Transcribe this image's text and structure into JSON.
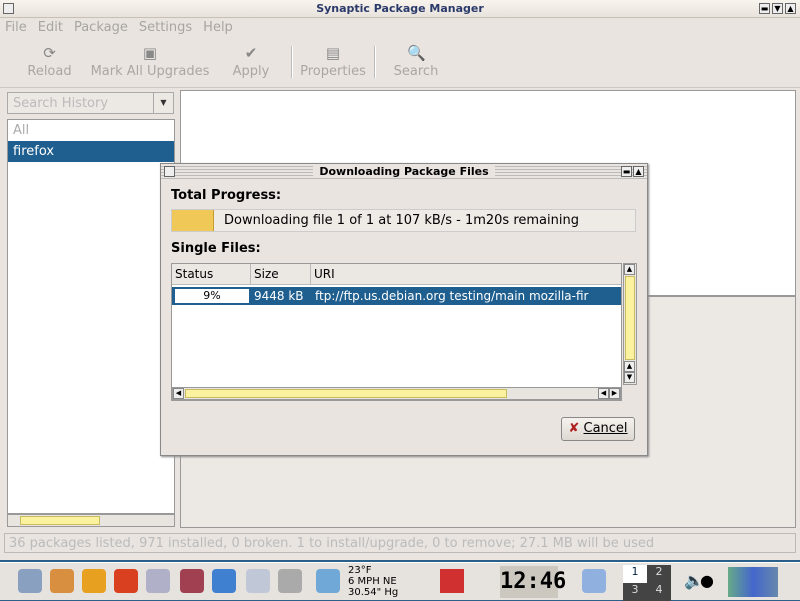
{
  "window": {
    "title": "Synaptic Package Manager"
  },
  "menu": [
    "File",
    "Edit",
    "Package",
    "Settings",
    "Help"
  ],
  "toolbar": {
    "reload": "Reload",
    "mark_all": "Mark All Upgrades",
    "apply": "Apply",
    "properties": "Properties",
    "search": "Search"
  },
  "sidebar": {
    "combo": "Search History",
    "items": [
      "All",
      "firefox"
    ]
  },
  "status": "36 packages listed, 971 installed, 0 broken. 1 to install/upgrade, 0 to remove; 27.1 MB will be used",
  "dialog": {
    "title": "Downloading Package Files",
    "total_label": "Total Progress:",
    "total_text": "Downloading file 1 of 1 at 107 kB/s - 1m20s remaining",
    "total_progress": 0.09,
    "single_label": "Single Files:",
    "columns": [
      "Status",
      "Size",
      "URI"
    ],
    "rows": [
      {
        "status": "9%",
        "size": "9448 kB",
        "uri": "ftp://ftp.us.debian.org testing/main mozilla-fir"
      }
    ],
    "cancel": "Cancel"
  },
  "taskbar": {
    "weather": [
      "23°F",
      "6 MPH NE",
      "30.54\" Hg"
    ],
    "clock": "12:46",
    "desktops": [
      "1",
      "2",
      "3",
      "4"
    ]
  }
}
